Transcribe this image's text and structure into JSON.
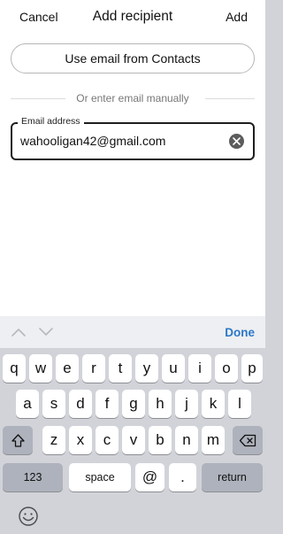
{
  "nav": {
    "cancel_label": "Cancel",
    "title": "Add recipient",
    "add_label": "Add"
  },
  "contacts_button_label": "Use email from Contacts",
  "divider_text": "Or enter email manually",
  "email_field": {
    "label": "Email address",
    "value": "wahooligan42@gmail.com"
  },
  "accessory": {
    "done_label": "Done"
  },
  "keyboard": {
    "row1": [
      "q",
      "w",
      "e",
      "r",
      "t",
      "y",
      "u",
      "i",
      "o",
      "p"
    ],
    "row2": [
      "a",
      "s",
      "d",
      "f",
      "g",
      "h",
      "j",
      "k",
      "l"
    ],
    "row3": [
      "z",
      "x",
      "c",
      "v",
      "b",
      "n",
      "m"
    ],
    "numbers_label": "123",
    "space_label": "space",
    "at_label": "@",
    "dot_label": ".",
    "return_label": "return"
  },
  "colors": {
    "accent": "#2b78c7",
    "keyboard_bg": "#d1d3d9",
    "special_key": "#aeb2bc"
  },
  "icons": {
    "clear": "clear-x-circle-icon",
    "shift": "shift-arrow-icon",
    "delete": "backspace-icon",
    "emoji": "emoji-smiley-icon",
    "up": "chevron-up-icon",
    "down": "chevron-down-icon"
  }
}
